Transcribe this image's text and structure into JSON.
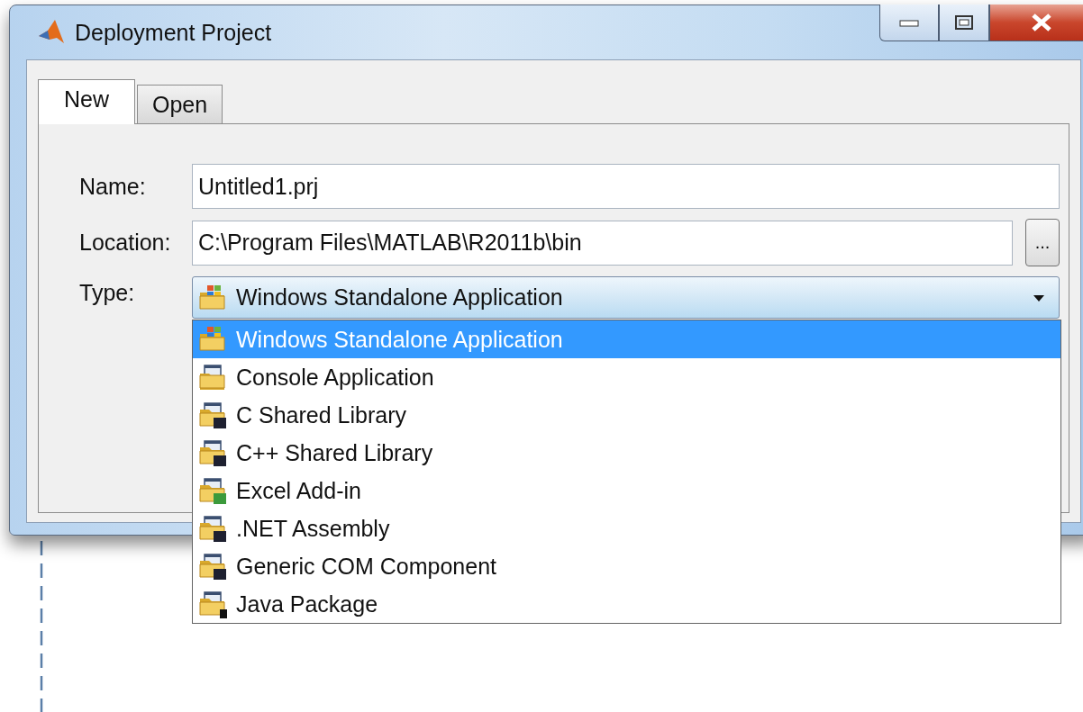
{
  "window": {
    "title": "Deployment Project"
  },
  "tabs": [
    {
      "label": "New",
      "selected": true
    },
    {
      "label": "Open",
      "selected": false
    }
  ],
  "form": {
    "name": {
      "label": "Name:",
      "value": "Untitled1.prj"
    },
    "location": {
      "label": "Location:",
      "value": "C:\\Program Files\\MATLAB\\R2011b\\bin",
      "browse": "..."
    },
    "type": {
      "label": "Type:",
      "value": "Windows Standalone Application",
      "kind": "windows",
      "expanded": true
    }
  },
  "type_options": [
    {
      "label": "Windows Standalone Application",
      "kind": "windows",
      "selected": true
    },
    {
      "label": "Console Application",
      "kind": "console",
      "selected": false
    },
    {
      "label": "C Shared Library",
      "kind": "c",
      "selected": false
    },
    {
      "label": "C++ Shared Library",
      "kind": "cpp",
      "selected": false
    },
    {
      "label": "Excel Add-in",
      "kind": "excel",
      "selected": false
    },
    {
      "label": ".NET Assembly",
      "kind": "net",
      "selected": false
    },
    {
      "label": "Generic COM Component",
      "kind": "com",
      "selected": false
    },
    {
      "label": "Java Package",
      "kind": "java",
      "selected": false
    }
  ]
}
